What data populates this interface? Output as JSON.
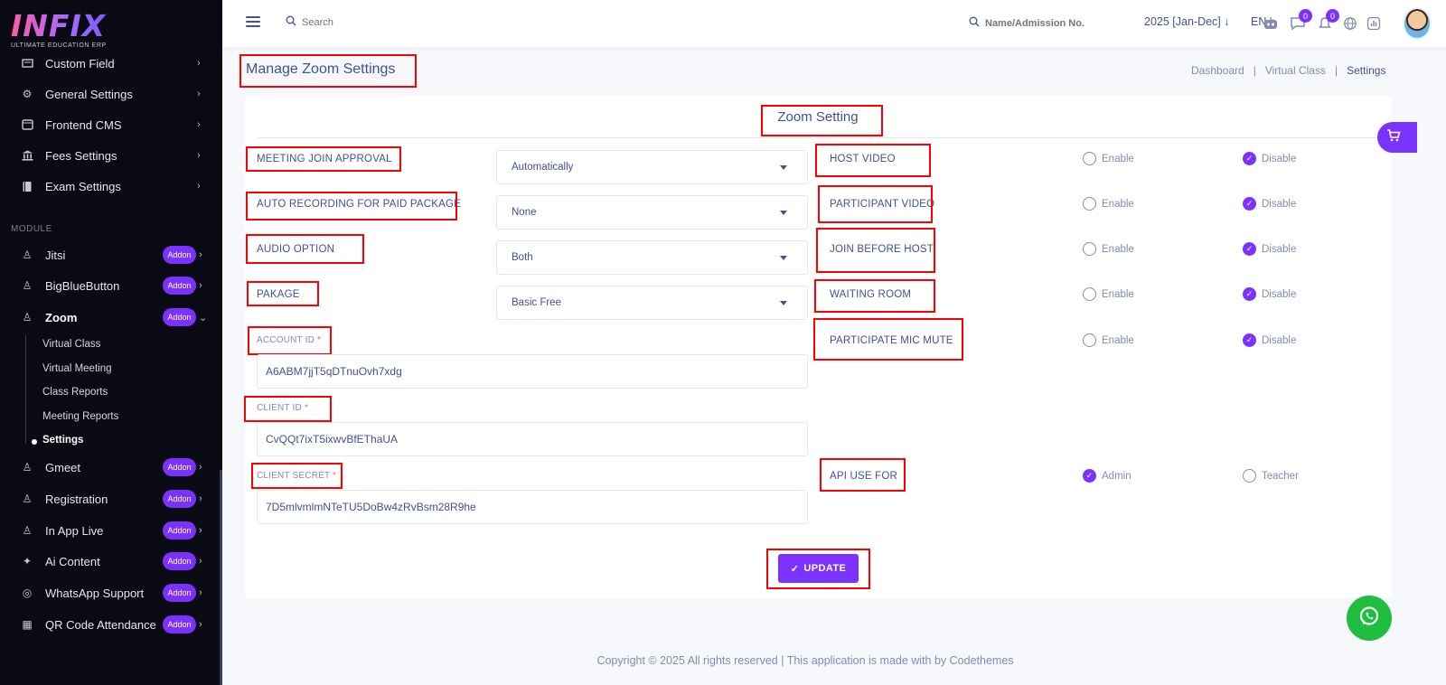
{
  "brand": {
    "logo_text": "INFIX",
    "tagline": "ULTIMATE EDUCATION ERP"
  },
  "sidebar": {
    "items": [
      {
        "label": "Custom Field",
        "icon": "form-icon"
      },
      {
        "label": "General Settings",
        "icon": "gears-icon"
      },
      {
        "label": "Frontend CMS",
        "icon": "cms-icon"
      },
      {
        "label": "Fees Settings",
        "icon": "bank-icon"
      },
      {
        "label": "Exam Settings",
        "icon": "book-icon"
      }
    ],
    "module_header": "MODULE",
    "modules": [
      {
        "label": "Jitsi",
        "badge": "Addon"
      },
      {
        "label": "BigBlueButton",
        "badge": "Addon"
      },
      {
        "label": "Zoom",
        "badge": "Addon"
      },
      {
        "label": "Gmeet",
        "badge": "Addon"
      },
      {
        "label": "Registration",
        "badge": "Addon"
      },
      {
        "label": "In App Live",
        "badge": "Addon"
      },
      {
        "label": "Ai Content",
        "badge": "Addon"
      },
      {
        "label": "WhatsApp Support",
        "badge": "Addon"
      },
      {
        "label": "QR Code Attendance",
        "badge": "Addon"
      }
    ],
    "zoom_sub": [
      "Virtual Class",
      "Virtual Meeting",
      "Class Reports",
      "Meeting Reports",
      "Settings"
    ]
  },
  "topbar": {
    "search_placeholder": "Search",
    "name_search_placeholder": "Name/Admission No.",
    "session": "2025 [Jan-Dec]",
    "language": "EN",
    "chat_count": "0",
    "notification_count": "0"
  },
  "header": {
    "title": "Manage Zoom Settings",
    "breadcrumb": [
      "Dashboard",
      "Virtual Class",
      "Settings"
    ]
  },
  "card": {
    "title": "Zoom Setting",
    "meeting_join_approval": {
      "label": "MEETING JOIN APPROVAL",
      "value": "Automatically"
    },
    "auto_recording": {
      "label": "AUTO RECORDING FOR PAID PACKAGE",
      "value": "None"
    },
    "audio_option": {
      "label": "AUDIO OPTION",
      "value": "Both"
    },
    "package": {
      "label": "PAKAGE",
      "value": "Basic Free"
    },
    "account_id": {
      "label": "ACCOUNT ID",
      "value": "A6ABM7jjT5qDTnuOvh7xdg"
    },
    "client_id": {
      "label": "CLIENT ID",
      "value": "CvQQt7ixT5ixwvBfEThaUA"
    },
    "client_secret": {
      "label": "CLIENT SECRET",
      "value": "7D5mlvmlmNTeTU5DoBw4zRvBsm28R9he"
    },
    "required_mark": "*",
    "toggles": [
      {
        "label": "HOST VIDEO",
        "opt1": "Enable",
        "opt2": "Disable",
        "selected": "Disable"
      },
      {
        "label": "PARTICIPANT VIDEO",
        "opt1": "Enable",
        "opt2": "Disable",
        "selected": "Disable"
      },
      {
        "label": "JOIN BEFORE HOST",
        "opt1": "Enable",
        "opt2": "Disable",
        "selected": "Disable"
      },
      {
        "label": "WAITING ROOM",
        "opt1": "Enable",
        "opt2": "Disable",
        "selected": "Disable"
      },
      {
        "label": "PARTICIPATE MIC MUTE",
        "opt1": "Enable",
        "opt2": "Disable",
        "selected": "Disable"
      }
    ],
    "api_use_for": {
      "label": "API USE FOR",
      "opt1": "Admin",
      "opt2": "Teacher",
      "selected": "Admin"
    },
    "update_label": "UPDATE"
  },
  "footer": {
    "text": "Copyright © 2025 All rights reserved | This application is made with by Codethemes"
  },
  "colors": {
    "accent": "#7c32ff",
    "sidebar_bg": "#0a0a14",
    "text": "#415094",
    "highlight": "#ff0000",
    "whatsapp": "#1fbe3f"
  }
}
